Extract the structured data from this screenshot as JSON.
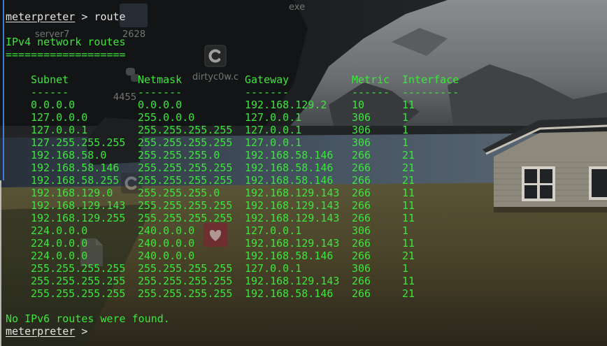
{
  "session": {
    "prompt": "meterpreter",
    "separator": " > ",
    "command": "route"
  },
  "ipv4": {
    "title": "IPv4 network routes",
    "title_rule": "===================",
    "columns": [
      {
        "label": "Subnet",
        "rule": "------"
      },
      {
        "label": "Netmask",
        "rule": "-------"
      },
      {
        "label": "Gateway",
        "rule": "-------"
      },
      {
        "label": "Metric",
        "rule": "------"
      },
      {
        "label": "Interface",
        "rule": "---------"
      }
    ],
    "routes": [
      {
        "subnet": "0.0.0.0",
        "netmask": "0.0.0.0",
        "gateway": "192.168.129.2",
        "metric": "10",
        "interface": "11"
      },
      {
        "subnet": "127.0.0.0",
        "netmask": "255.0.0.0",
        "gateway": "127.0.0.1",
        "metric": "306",
        "interface": "1"
      },
      {
        "subnet": "127.0.0.1",
        "netmask": "255.255.255.255",
        "gateway": "127.0.0.1",
        "metric": "306",
        "interface": "1"
      },
      {
        "subnet": "127.255.255.255",
        "netmask": "255.255.255.255",
        "gateway": "127.0.0.1",
        "metric": "306",
        "interface": "1"
      },
      {
        "subnet": "192.168.58.0",
        "netmask": "255.255.255.0",
        "gateway": "192.168.58.146",
        "metric": "266",
        "interface": "21"
      },
      {
        "subnet": "192.168.58.146",
        "netmask": "255.255.255.255",
        "gateway": "192.168.58.146",
        "metric": "266",
        "interface": "21"
      },
      {
        "subnet": "192.168.58.255",
        "netmask": "255.255.255.255",
        "gateway": "192.168.58.146",
        "metric": "266",
        "interface": "21"
      },
      {
        "subnet": "192.168.129.0",
        "netmask": "255.255.255.0",
        "gateway": "192.168.129.143",
        "metric": "266",
        "interface": "11"
      },
      {
        "subnet": "192.168.129.143",
        "netmask": "255.255.255.255",
        "gateway": "192.168.129.143",
        "metric": "266",
        "interface": "11"
      },
      {
        "subnet": "192.168.129.255",
        "netmask": "255.255.255.255",
        "gateway": "192.168.129.143",
        "metric": "266",
        "interface": "11"
      },
      {
        "subnet": "224.0.0.0",
        "netmask": "240.0.0.0",
        "gateway": "127.0.0.1",
        "metric": "306",
        "interface": "1"
      },
      {
        "subnet": "224.0.0.0",
        "netmask": "240.0.0.0",
        "gateway": "192.168.129.143",
        "metric": "266",
        "interface": "11"
      },
      {
        "subnet": "224.0.0.0",
        "netmask": "240.0.0.0",
        "gateway": "192.168.58.146",
        "metric": "266",
        "interface": "21"
      },
      {
        "subnet": "255.255.255.255",
        "netmask": "255.255.255.255",
        "gateway": "127.0.0.1",
        "metric": "306",
        "interface": "1"
      },
      {
        "subnet": "255.255.255.255",
        "netmask": "255.255.255.255",
        "gateway": "192.168.129.143",
        "metric": "266",
        "interface": "11"
      },
      {
        "subnet": "255.255.255.255",
        "netmask": "255.255.255.255",
        "gateway": "192.168.58.146",
        "metric": "266",
        "interface": "21"
      }
    ]
  },
  "ipv6": {
    "message": "No IPv6 routes were found."
  },
  "input_prompt": {
    "prompt": "meterpreter",
    "separator": " >"
  },
  "desktop": {
    "icons": [
      {
        "label": "exe",
        "icon": "file-icon"
      },
      {
        "label": "server7",
        "icon": "file-icon"
      },
      {
        "label": "2628",
        "icon": "file-icon"
      },
      {
        "label": "dirtyc0w.c",
        "icon": "c-source-icon"
      },
      {
        "label": "4455",
        "icon": "python-icon"
      },
      {
        "icon": "c-source-icon"
      },
      {
        "icon": "heart-icon"
      },
      {
        "icon": "file-icon"
      }
    ]
  },
  "colors": {
    "output_text": "#3ce63c",
    "prompt_text": "#e4e4e4",
    "window_border": "#3c7fd6",
    "icon_label": "#8c8c8c"
  }
}
